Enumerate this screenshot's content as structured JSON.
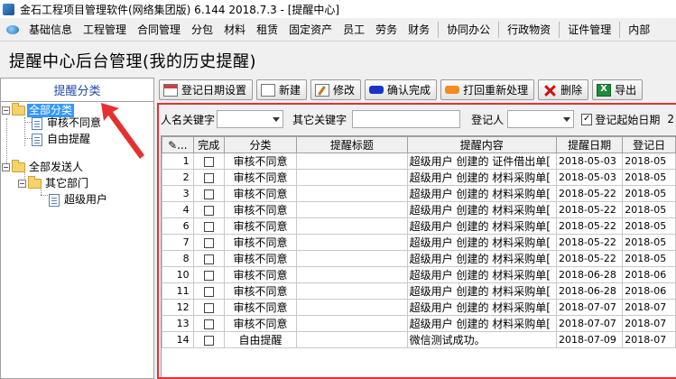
{
  "window": {
    "title": "金石工程项目管理软件(网络集团版) 6.144  2018.7.3 - [提醒中心]"
  },
  "menu": [
    "基础信息",
    "工程管理",
    "合同管理",
    "分包",
    "材料",
    "租赁",
    "固定资产",
    "员工",
    "劳务",
    "财务",
    "协同办公",
    "行政物资",
    "证件管理",
    "内部"
  ],
  "page": {
    "title": "提醒中心后台管理(我的历史提醒)"
  },
  "left_panel": {
    "header": "提醒分类",
    "tree": [
      {
        "label": "全部分类",
        "selected": true
      },
      {
        "label": "审核不同意"
      },
      {
        "label": "自由提醒"
      },
      {
        "label": "全部发送人"
      },
      {
        "label": "其它部门"
      },
      {
        "label": "超级用户"
      }
    ]
  },
  "toolbar": [
    "登记日期设置",
    "新建",
    "修改",
    "确认完成",
    "打回重新处理",
    "删除",
    "导出"
  ],
  "filters": {
    "name_keyword": "人名关键字",
    "other_keyword": "其它关键字",
    "registrant": "登记人",
    "start_date_label": "登记起始日期",
    "start_date_checked": true,
    "start_date_value": "2"
  },
  "table": {
    "columns": [
      "✎...",
      "完成",
      "分类",
      "提醒标题",
      "提醒内容",
      "提醒日期",
      "登记日"
    ],
    "rows": [
      {
        "no": "1",
        "category": "审核不同意",
        "content": "超级用户 创建的 证件借出单[",
        "date": "2018-05-03",
        "reg": "2018-05"
      },
      {
        "no": "2",
        "category": "审核不同意",
        "content": "超级用户 创建的 材料采购单[",
        "date": "2018-05-03",
        "reg": "2018-05"
      },
      {
        "no": "3",
        "category": "审核不同意",
        "content": "超级用户 创建的 材料采购单[",
        "date": "2018-05-22",
        "reg": "2018-05"
      },
      {
        "no": "4",
        "category": "审核不同意",
        "content": "超级用户 创建的 材料采购单[",
        "date": "2018-05-22",
        "reg": "2018-05"
      },
      {
        "no": "6",
        "category": "审核不同意",
        "content": "超级用户 创建的 材料采购单[",
        "date": "2018-05-22",
        "reg": "2018-05"
      },
      {
        "no": "7",
        "category": "审核不同意",
        "content": "超级用户 创建的 材料采购单[",
        "date": "2018-05-22",
        "reg": "2018-05"
      },
      {
        "no": "8",
        "category": "审核不同意",
        "content": "超级用户 创建的 材料采购单[",
        "date": "2018-05-22",
        "reg": "2018-05"
      },
      {
        "no": "10",
        "category": "审核不同意",
        "content": "超级用户 创建的 材料采购单[",
        "date": "2018-06-28",
        "reg": "2018-06"
      },
      {
        "no": "11",
        "category": "审核不同意",
        "content": "超级用户 创建的 材料采购单[",
        "date": "2018-06-28",
        "reg": "2018-06"
      },
      {
        "no": "12",
        "category": "审核不同意",
        "content": "超级用户 创建的 材料采购单[",
        "date": "2018-07-07",
        "reg": "2018-07"
      },
      {
        "no": "13",
        "category": "审核不同意",
        "content": "超级用户 创建的 材料采购单[",
        "date": "2018-07-07",
        "reg": "2018-07"
      },
      {
        "no": "14",
        "category": "自由提醒",
        "content": "微信测试成功。",
        "date": "2018-07-09",
        "reg": "2018-07"
      }
    ]
  }
}
